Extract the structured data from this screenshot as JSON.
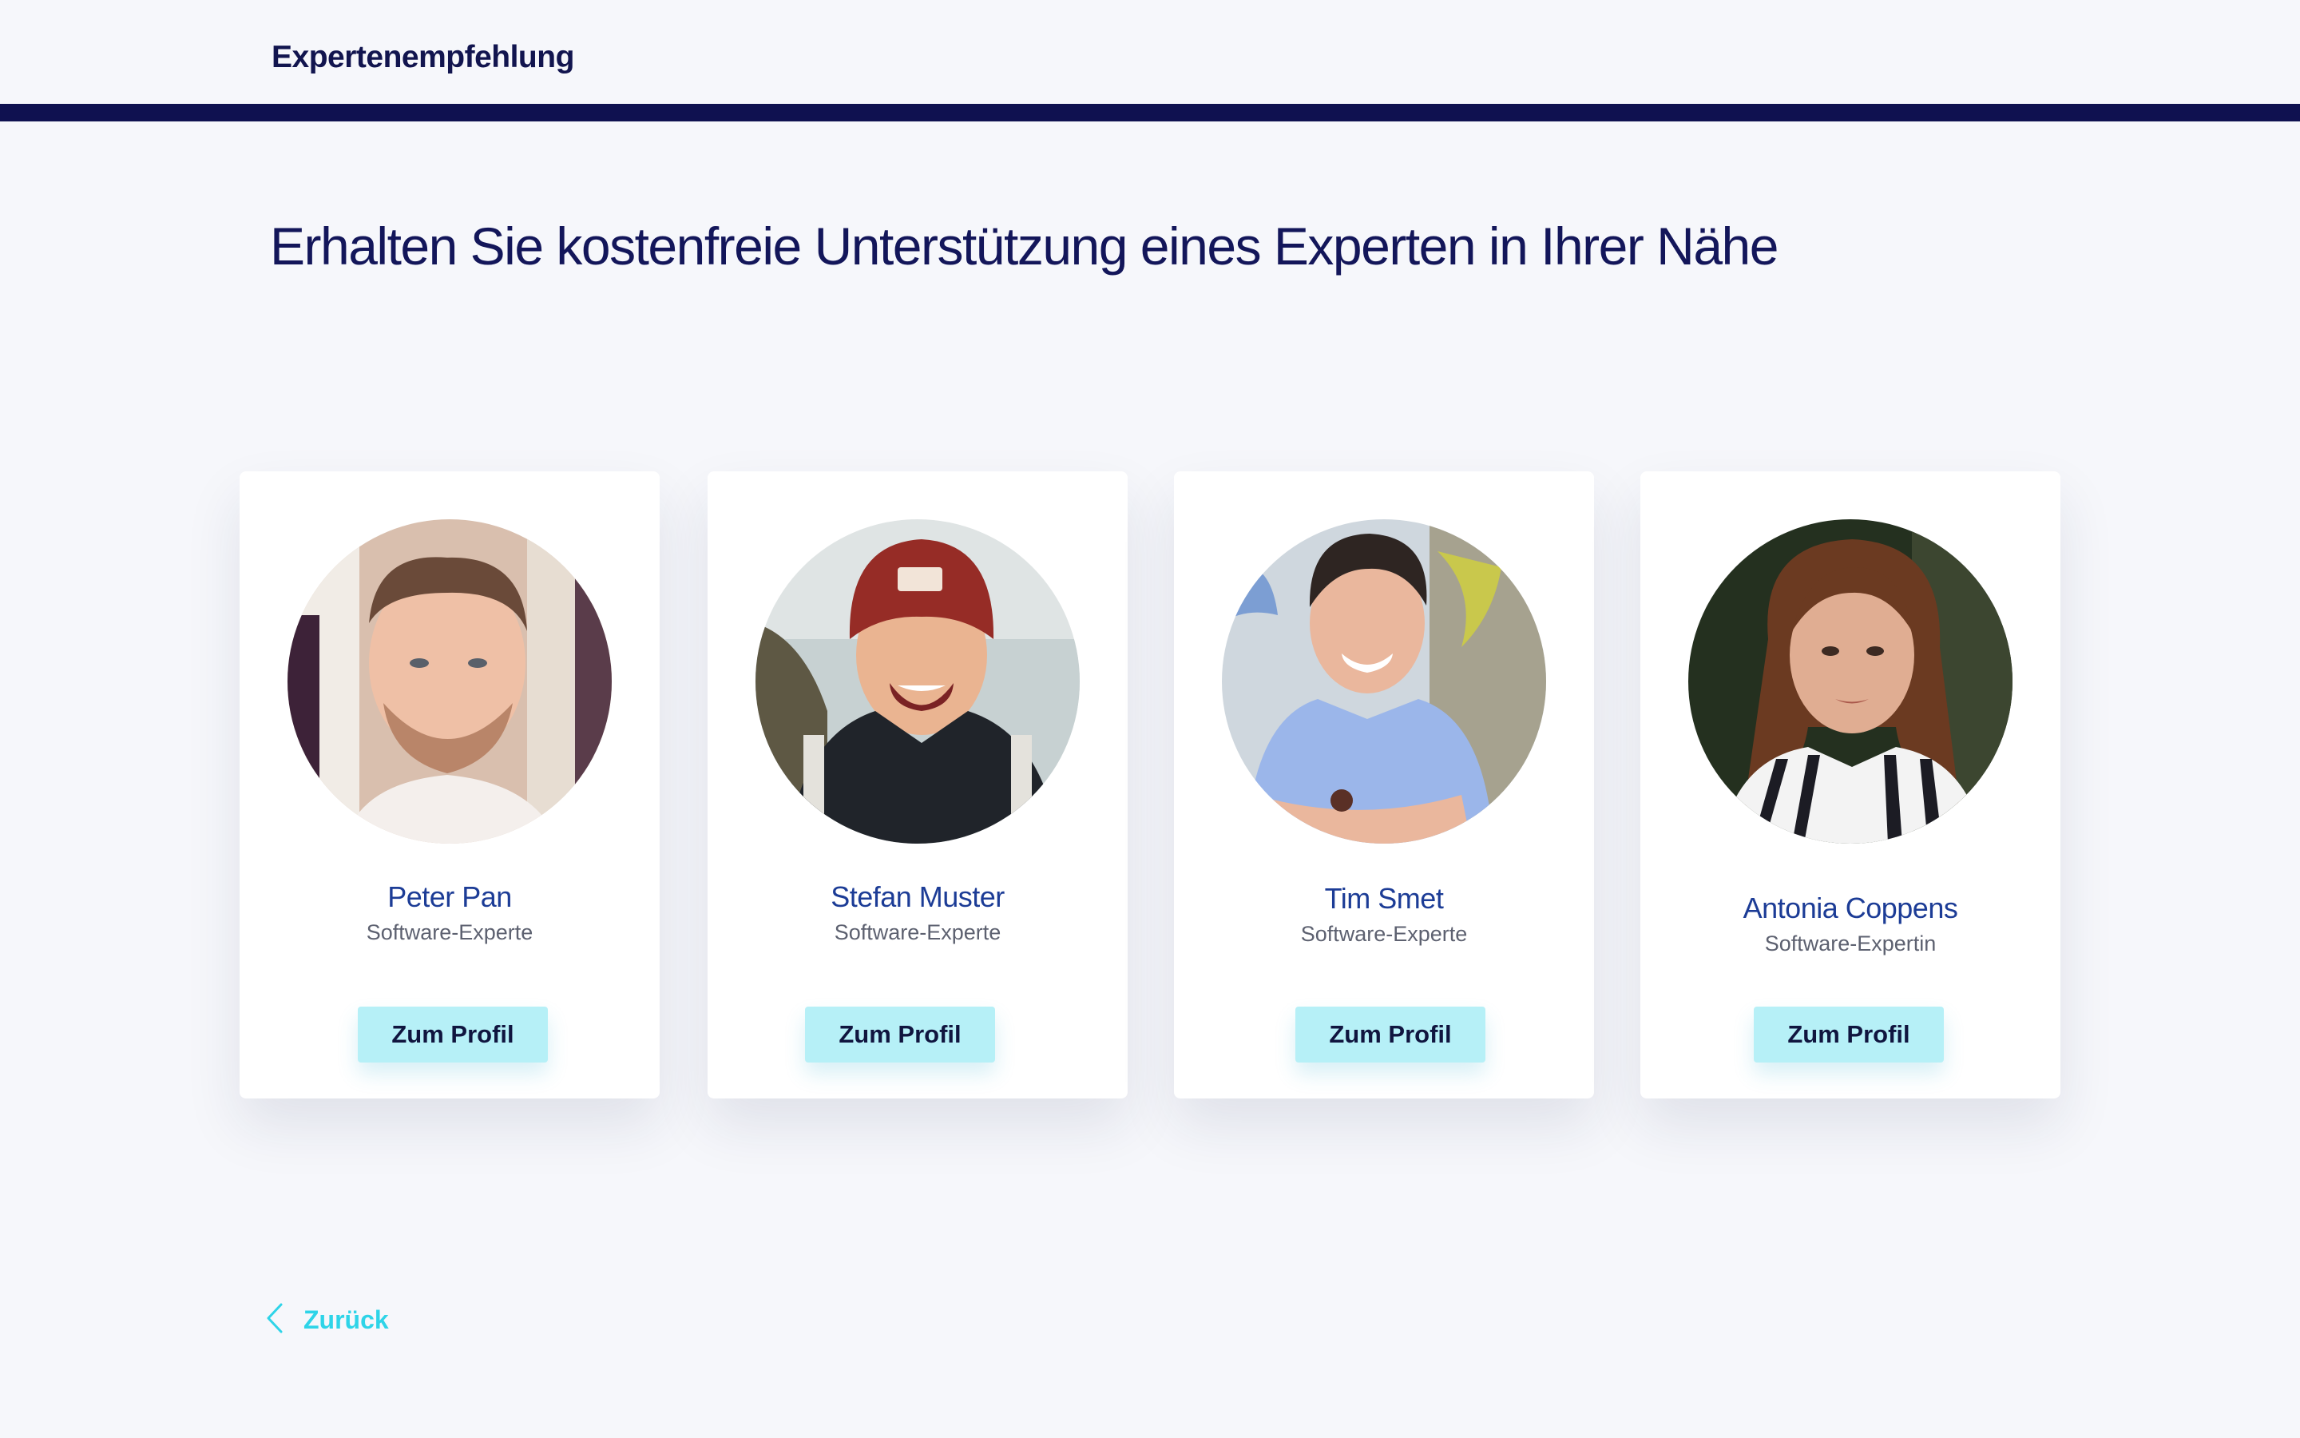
{
  "header": {
    "brand": "Expertenempfehlung"
  },
  "main": {
    "headline": "Erhalten Sie kostenfreie Unterstützung eines Experten in Ihrer Nähe"
  },
  "experts": [
    {
      "name": "Peter Pan",
      "role": "Software-Experte",
      "button_label": "Zum Profil"
    },
    {
      "name": "Stefan Muster",
      "role": "Software-Experte",
      "button_label": "Zum Profil"
    },
    {
      "name": "Tim Smet",
      "role": "Software-Experte",
      "button_label": "Zum Profil"
    },
    {
      "name": "Antonia Coppens",
      "role": "Software-Expertin",
      "button_label": "Zum Profil"
    }
  ],
  "footer": {
    "back_label": "Zurück",
    "back_icon": "chevron-left-icon"
  },
  "colors": {
    "background": "#f6f7fb",
    "header_bar": "#0f1150",
    "headline": "#13165a",
    "name": "#1c3c96",
    "button": "#b6f0f7",
    "back_link": "#2ed4e8"
  }
}
